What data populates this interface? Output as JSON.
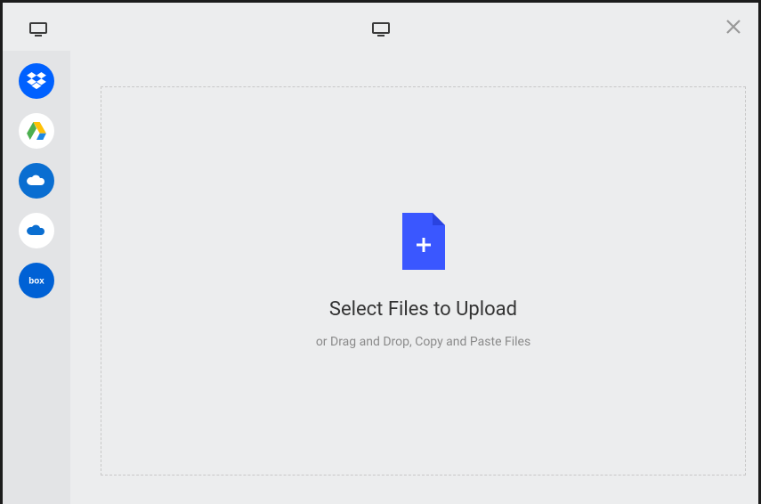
{
  "upload": {
    "headline": "Select Files to Upload",
    "subline": "or Drag and Drop, Copy and Paste Files"
  },
  "sources": [
    {
      "id": "dropbox",
      "name": "Dropbox",
      "active": true
    },
    {
      "id": "googledrive",
      "name": "Google Drive",
      "active": false
    },
    {
      "id": "onedrive",
      "name": "OneDrive",
      "active": false
    },
    {
      "id": "onedrive-business",
      "name": "OneDrive for Business",
      "active": false
    },
    {
      "id": "box",
      "name": "Box",
      "active": false
    }
  ],
  "colors": {
    "accent": "#3a57ff",
    "dropbox": "#0061ff",
    "onedrive": "#0a6ed1",
    "box": "#0061d5"
  }
}
